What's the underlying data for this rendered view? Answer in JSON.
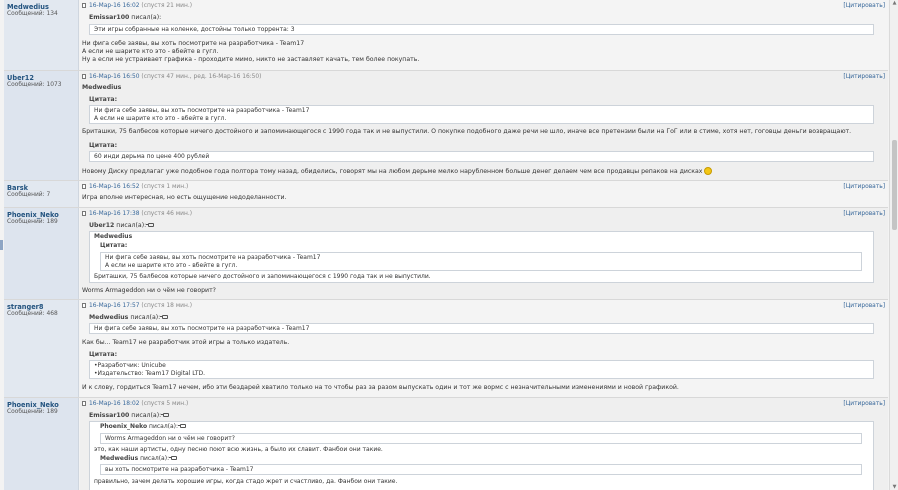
{
  "posts": [
    {
      "user": "Medwedius",
      "count": "Сообщений: 134",
      "date": "16-Мар-16 16:02",
      "meta": "(спустя 21 мин.)",
      "cite": "[Цитировать]",
      "quote_author": "Emissar100",
      "quote_said": "писал(а):",
      "quote_line": "Эти игры собранные на коленке, достойны только торрента: 3",
      "lines": [
        "Ни фига себе заявы, вы хоть посмотрите на разработчика - Team17",
        "А если не шарите кто это - вбейте в гугл.",
        "Ну а если не устраивает графика - проходите мимо, никто не заставляет качать, тем более покупать."
      ]
    },
    {
      "user": "Uber12",
      "count": "Сообщений: 1073",
      "date": "16-Мар-16 16:50",
      "meta": "(спустя 47 мин., ред. 16-Мар-16 16:50)",
      "cite": "[Цитировать]",
      "addressee": "Medwedius",
      "quote_label": "Цитата:",
      "quote1": [
        "Ни фига себе заявы, вы хоть посмотрите на разработчика - Team17",
        "А если не шарите кто это - вбейте в гугл."
      ],
      "text1": "Бриташки, 75 балбесов которые ничего достойного и запоминающегося с 1990 года так и не выпустили. О покупке подобного даже речи не шло, иначе все претензии были на ГоГ или в стиме, хотя нет, гоговцы деньги возвращают.",
      "quote2": "60 инди дерьма по цене 400 рублей",
      "text2": "Новому Диску предлагаг уже подобное года полтора тому назад, обиделись, говорят мы на любом дерьме мелко нарубленном больше денег делаем чем все продавцы репаков на дисках"
    },
    {
      "user": "Barsk",
      "count": "Сообщений: 7",
      "date": "16-Мар-16 16:52",
      "meta": "(спустя 1 мин.)",
      "cite": "[Цитировать]",
      "text": "Игра вполне интересная, но есть ощущение недоделанности."
    },
    {
      "user": "Phoenix_Neko",
      "count": "Сообщений: 189",
      "date": "16-Мар-16 17:38",
      "meta": "(спустя 46 мин.)",
      "cite": "[Цитировать]",
      "quote_author": "Uber12",
      "quote_said": "писал(а):",
      "inner_author": "Medwedius",
      "inner_label": "Цитата:",
      "inner_quote": [
        "Ни фига себе заявы, вы хоть посмотрите на разработчика - Team17",
        "А если не шарите кто это - вбейте в гугл."
      ],
      "inner_text": "Бриташки, 75 балбесов которые ничего достойного и запоминающегося с 1990 года так и не выпустили.",
      "text": "Worms Armageddon ни о чём не говорит?"
    },
    {
      "user": "stranger8",
      "count": "Сообщений: 468",
      "date": "16-Мар-16 17:57",
      "meta": "(спустя 18 мин.)",
      "cite": "[Цитировать]",
      "quote_author": "Medwedius",
      "quote_said": "писал(а):",
      "quote_line": "Ни фига себе заявы, вы хоть посмотрите на разработчика - Team17",
      "text1": "Как бы... Team17 не разработчик этой игры а только издатель.",
      "quote_label": "Цитата:",
      "quote2": [
        "•Разработчик: Unicube",
        "•Издательство: Team17 Digital LTD."
      ],
      "text2": "И к слову, гордиться Team17 нечем, ибо эти бездарей хватило только на то чтобы раз за разом выпускать один и тот же вормс с незначительными изменениями и новой графикой."
    },
    {
      "user": "Phoenix_Neko",
      "count": "Сообщений: 189",
      "date": "16-Мар-16 18:02",
      "meta": "(спустя 5 мин.)",
      "cite": "[Цитировать]",
      "quote_author": "Emissar100",
      "quote_said": "писал(а):",
      "inner1_author": "Phoenix_Neko",
      "inner1_said": "писал(а):",
      "inner1_line": "Worms Armageddon ни о чём не говорит?",
      "mid_text": "это, как наши артисты, одну песню поют всю жизнь, а было их славит. Фанбои они такие.",
      "inner2_author": "Medwedius",
      "inner2_said": "писал(а):",
      "inner2_line": "вы хоть посмотрите на разработчика - Team17",
      "tail_text": "правильно, зачем делать хорошие игры, когда стадо жрет и счастливо, да. Фанбои они такие."
    }
  ]
}
